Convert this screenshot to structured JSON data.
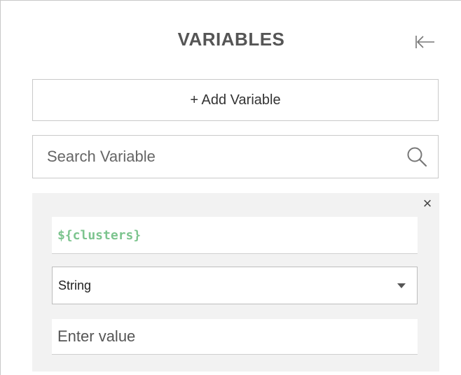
{
  "header": {
    "title": "VARIABLES",
    "collapse_icon": "collapse-left-icon"
  },
  "toolbar": {
    "add_variable_label": "+ Add Variable"
  },
  "search": {
    "placeholder": "Search Variable",
    "value": "",
    "icon": "search-icon"
  },
  "variable_card": {
    "name": "${clusters}",
    "type_selected": "String",
    "value_placeholder": "Enter value",
    "value": "",
    "close_glyph": "×",
    "name_color": "#7cc48e"
  }
}
